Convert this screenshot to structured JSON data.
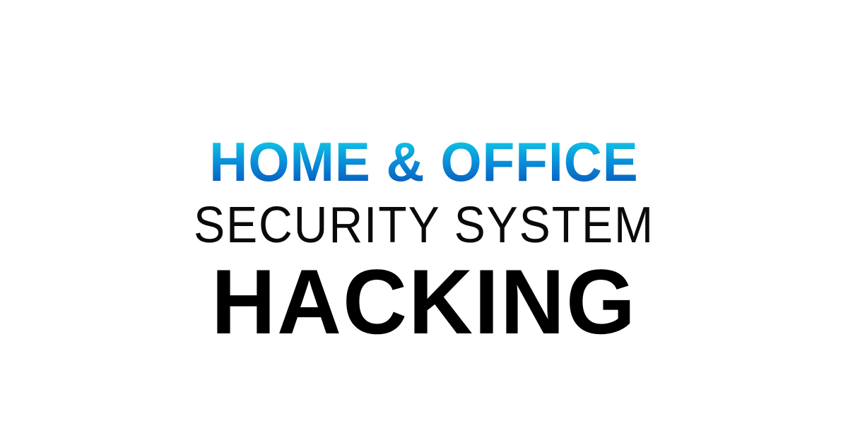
{
  "headline": {
    "line1": "HOME & OFFICE",
    "line2": "SECURITY SYSTEM",
    "line3": "HACKING"
  },
  "colors": {
    "background": "#ffffff",
    "gradient_top": "#12d3e8",
    "gradient_bottom": "#0752b8",
    "text_dark": "#000000"
  }
}
